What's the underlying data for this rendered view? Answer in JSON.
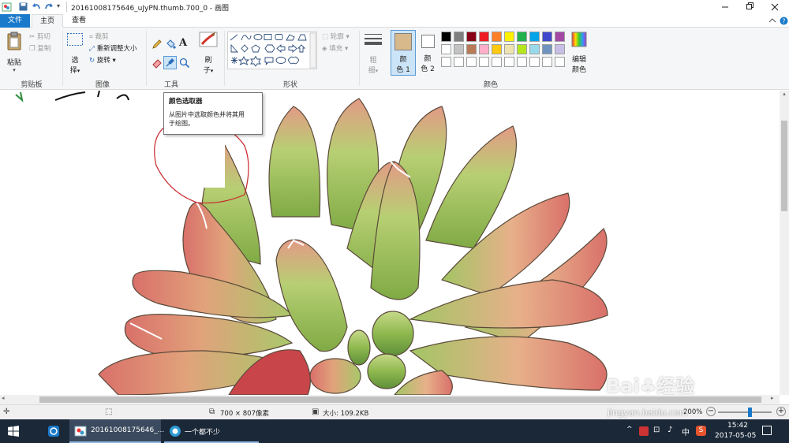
{
  "window": {
    "title": "20161008175646_uJyPN.thumb.700_0 - 画图",
    "qat_more": "▾"
  },
  "tabs": [
    {
      "label": "文件",
      "active_style": "file"
    },
    {
      "label": "主页",
      "active_style": "selected"
    },
    {
      "label": "查看",
      "active_style": "normal"
    }
  ],
  "ribbon": {
    "clipboard": {
      "paste": "粘贴",
      "cut": "剪切",
      "copy": "复制",
      "group": "剪贴板"
    },
    "image": {
      "select": "选",
      "select2": "择",
      "crop": "裁剪",
      "resize": "重新调整大小",
      "rotate": "旋转",
      "group": "图像"
    },
    "tools": {
      "group": "工具"
    },
    "brushes": {
      "label1": "刷",
      "label2": "子"
    },
    "shapes": {
      "outline": "轮廓",
      "fill": "填充",
      "group": "形状"
    },
    "size": {
      "label1": "粗",
      "label2": "细"
    },
    "colors": {
      "color1_a": "颜",
      "color1_b": "色 1",
      "color2_a": "颜",
      "color2_b": "色 2",
      "edit_a": "编辑",
      "edit_b": "颜色",
      "group": "颜色",
      "color1_value": "#d8b98c",
      "color2_value": "#ffffff",
      "palette_row1": [
        "#000000",
        "#7f7f7f",
        "#880015",
        "#ed1c24",
        "#ff7f27",
        "#fff200",
        "#22b14c",
        "#00a2e8",
        "#3f48cc",
        "#a349a4"
      ],
      "palette_row2": [
        "#ffffff",
        "#c3c3c3",
        "#b97a57",
        "#ffaec9",
        "#ffc90e",
        "#efe4b0",
        "#b5e61d",
        "#99d9ea",
        "#7092be",
        "#c8bfe7"
      ]
    }
  },
  "tooltip": {
    "title": "颜色选取器",
    "body_line1": "从图片中选取颜色并将其用",
    "body_line2": "于绘图。"
  },
  "status": {
    "dimensions": "700 × 807像素",
    "size": "大小: 109.2KB",
    "zoom": "200%",
    "zoom_fraction": 0.6
  },
  "taskbar": {
    "app1": "20161008175646_...",
    "app2": "一个都不少",
    "ime": "中",
    "time": "15:42",
    "date": "2017-05-05"
  },
  "watermark": {
    "line1": "Bai",
    "line2": "经验",
    "url": "jingyan.baidu.com"
  }
}
